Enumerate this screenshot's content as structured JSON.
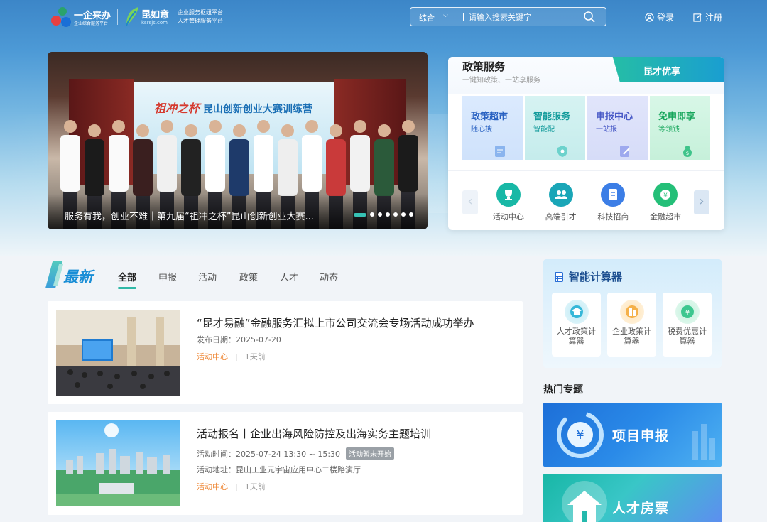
{
  "header": {
    "brand1_name": "一企来办",
    "brand1_sub": "企业综合服务平台",
    "brand2_name": "昆如意",
    "brand2_sub": "ksrsjs.com",
    "slogan_line1": "企业服务枢纽平台",
    "slogan_line2": "人才管理服务平台",
    "search_category": "综合",
    "search_placeholder": "请输入搜索关键字",
    "login": "登录",
    "register": "注册"
  },
  "banner": {
    "stage_text_red": "祖冲之杯",
    "stage_text_blue": "昆山创新创业大赛训练营",
    "caption": "服务有我，创业不难｜第九届“祖冲之杯”昆山创新创业大赛...",
    "slide_count": 7,
    "active_slide": 1
  },
  "policy": {
    "title": "政策服务",
    "subtitle": "一键知政策、一站享服务",
    "tag": "昆才优享",
    "cards": [
      {
        "title": "政策超市",
        "sub": "随心搜"
      },
      {
        "title": "智能服务",
        "sub": "智能配"
      },
      {
        "title": "申报中心",
        "sub": "一站报"
      },
      {
        "title": "免申即享",
        "sub": "等领钱"
      }
    ],
    "quick": [
      {
        "label": "活动中心"
      },
      {
        "label": "高端引才"
      },
      {
        "label": "科技招商"
      },
      {
        "label": "金融超市"
      }
    ]
  },
  "news": {
    "section_title": "最新",
    "tabs": [
      "全部",
      "申报",
      "活动",
      "政策",
      "人才",
      "动态"
    ],
    "active_tab": 0,
    "items": [
      {
        "title": "“昆才易融”金融服务汇拟上市公司交流会专场活动成功举办",
        "meta1": "发布日期：2025-07-20",
        "tag": "活动中心",
        "sep": "|",
        "time": "1天前"
      },
      {
        "title": "活动报名丨企业出海风险防控及出海实务主题培训",
        "meta1": "活动时间：2025-07-24 13:30 ~ 15:30",
        "badge": "活动暂未开始",
        "meta2": "活动地址：昆山工业元宇宙应用中心二楼路演厅",
        "tag": "活动中心",
        "sep": "|",
        "time": "1天前"
      }
    ]
  },
  "calculator": {
    "title": "智能计算器",
    "items": [
      {
        "label": "人才政策计算器"
      },
      {
        "label": "企业政策计算器"
      },
      {
        "label": "税费优惠计算器"
      }
    ]
  },
  "hot": {
    "title": "热门专题",
    "cards": [
      {
        "label": "项目申报"
      },
      {
        "label": "人才房票"
      }
    ]
  }
}
